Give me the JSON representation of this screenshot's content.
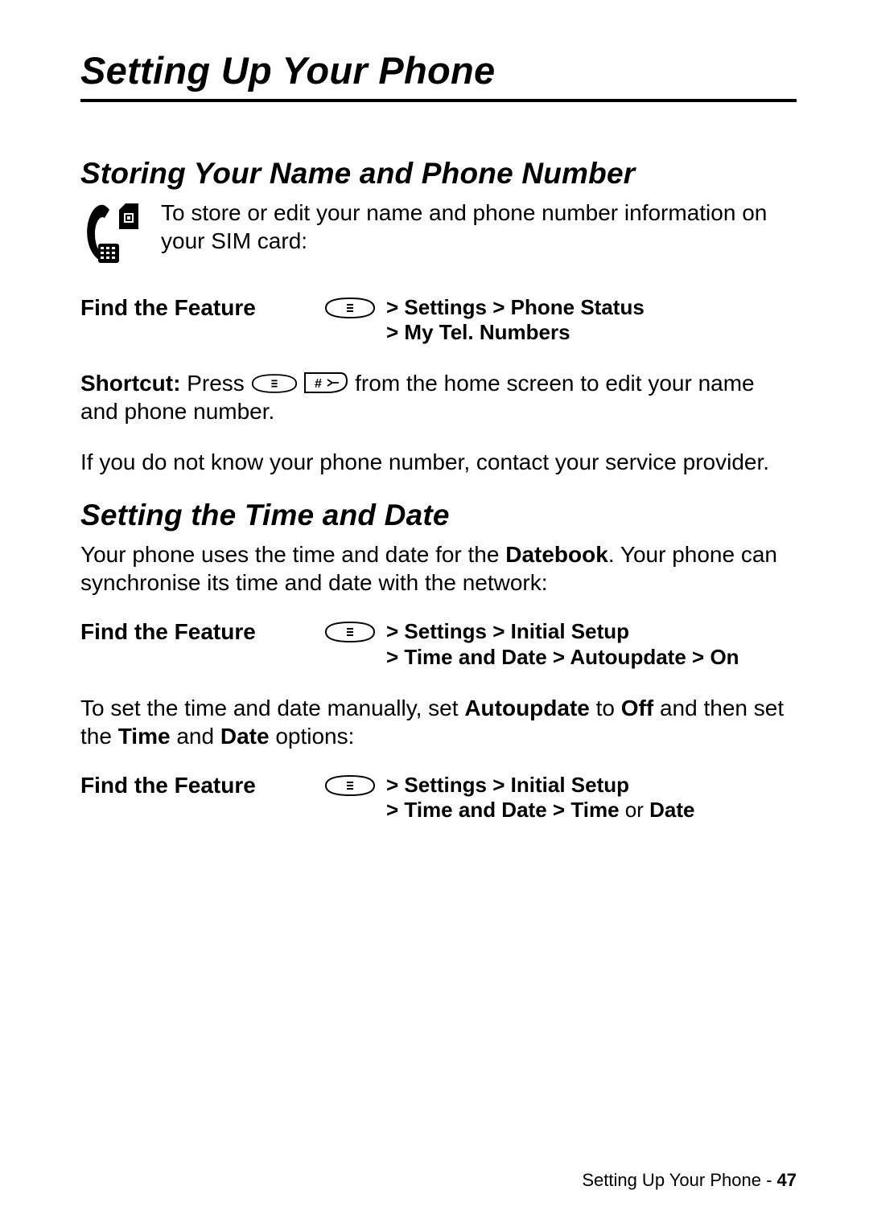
{
  "header": {
    "title": "Setting Up Your Phone"
  },
  "section1": {
    "heading": "Storing Your Name and Phone Number",
    "intro": "To store or edit your name and phone number information on your SIM card:",
    "feature_label": "Find the Feature",
    "nav_line1_settings": "Settings",
    "nav_line1_phone_status": "Phone Status",
    "nav_line2_mytel": "My Tel. Numbers",
    "shortcut_label": "Shortcut:",
    "shortcut_pre": " Press ",
    "shortcut_post": " from the home screen to edit your name and phone number.",
    "unknown": "If you do not know your phone number, contact your service provider."
  },
  "section2": {
    "heading": "Setting the Time and Date",
    "intro_pre": "Your phone uses the time and date for the ",
    "intro_bold": "Datebook",
    "intro_post": ". Your phone can synchronise its time and date with the network:",
    "feature_label": "Find the Feature",
    "navA_l1_settings": "Settings",
    "navA_l1_initial": "Initial Setup",
    "navA_l2_td": "Time and Date",
    "navA_l2_au": "Autoupdate",
    "navA_l2_on": "On",
    "manual_pre": "To set the time and date manually, set ",
    "manual_au": "Autoupdate",
    "manual_mid": " to ",
    "manual_off": "Off",
    "manual_post": " and then set the ",
    "manual_time": "Time",
    "manual_and": " and ",
    "manual_date": "Date",
    "manual_end": " options:",
    "navB_l1_settings": "Settings",
    "navB_l1_initial": "Initial Setup",
    "navB_l2_td": "Time and Date",
    "navB_l2_time": "Time",
    "navB_l2_or": "or",
    "navB_l2_date": "Date"
  },
  "footer": {
    "section": "Setting Up Your Phone",
    "dash": " - ",
    "page": "47"
  },
  "gt": ">"
}
